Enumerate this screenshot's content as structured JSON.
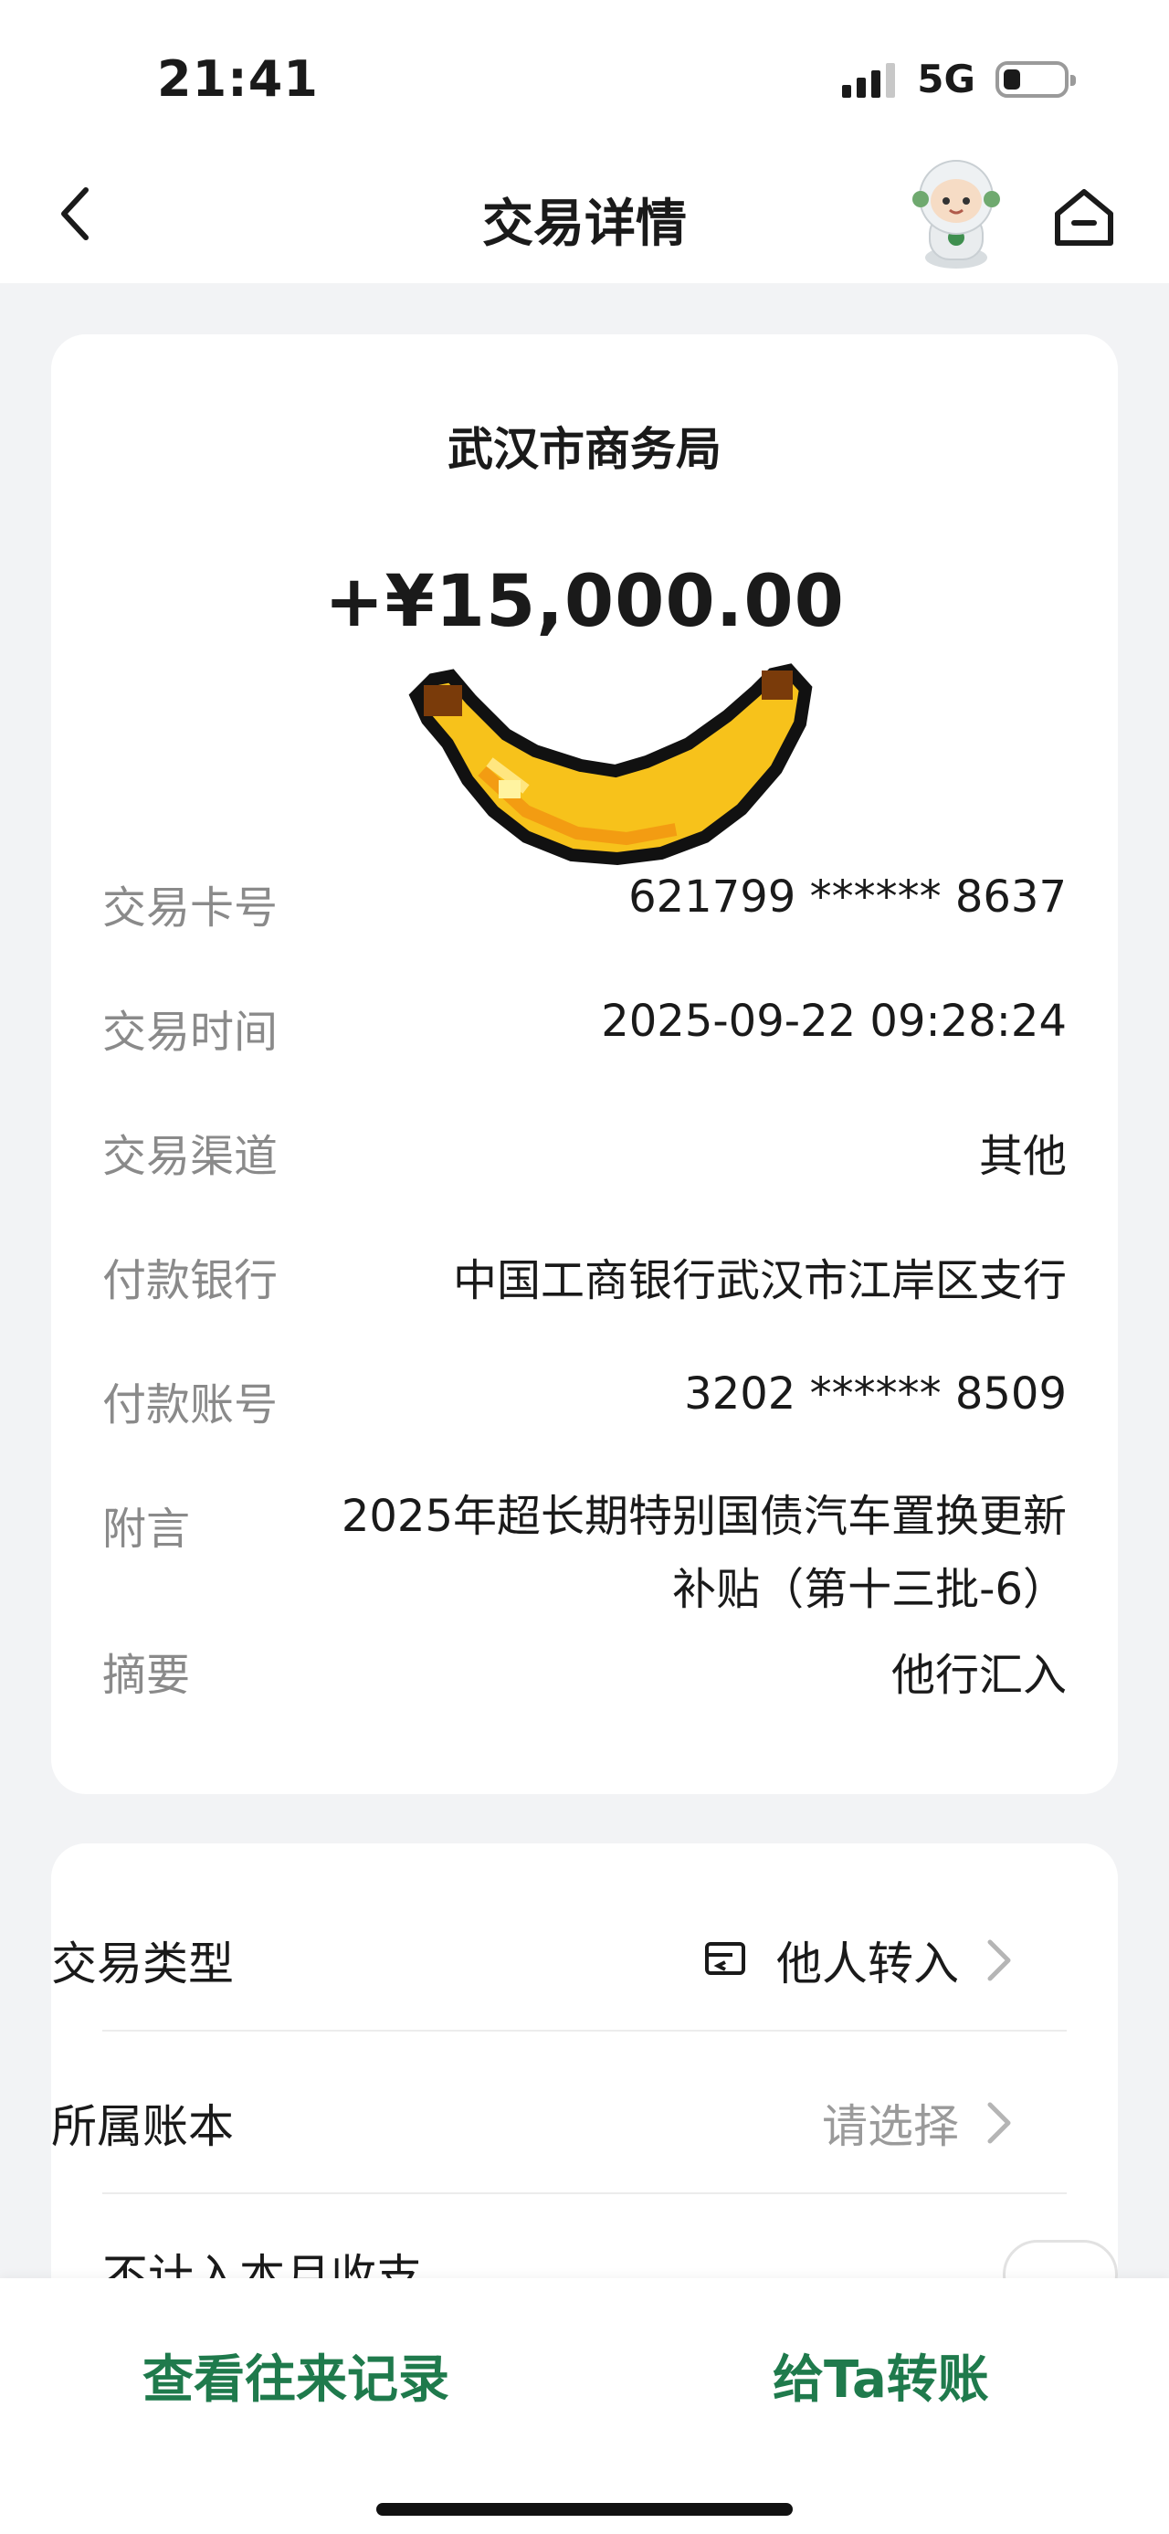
{
  "status_bar": {
    "time": "21:41",
    "network": "5G"
  },
  "nav": {
    "title": "交易详情"
  },
  "transaction": {
    "payer": "武汉市商务局",
    "amount": "+¥15,000.00",
    "details": [
      {
        "label": "交易卡号",
        "value": "621799 ****** 8637"
      },
      {
        "label": "交易时间",
        "value": "2025-09-22 09:28:24"
      },
      {
        "label": "交易渠道",
        "value": "其他"
      },
      {
        "label": "付款银行",
        "value": "中国工商银行武汉市江岸区支行"
      },
      {
        "label": "付款账号",
        "value": "3202 ****** 8509"
      },
      {
        "label": "附言",
        "value": "2025年超长期特别国债汽车置换更新补贴（第十三批-6）"
      },
      {
        "label": "摘要",
        "value": "他行汇入"
      }
    ]
  },
  "settings": {
    "transaction_type": {
      "label": "交易类型",
      "value": "他人转入"
    },
    "ledger": {
      "label": "所属账本",
      "value": "请选择"
    },
    "exclude_month": {
      "label": "不计入本月收支"
    }
  },
  "actions": {
    "history": "查看往来记录",
    "transfer": "给Ta转账"
  },
  "colors": {
    "accent": "#1f7a4c",
    "banana": "#f7c21b"
  }
}
